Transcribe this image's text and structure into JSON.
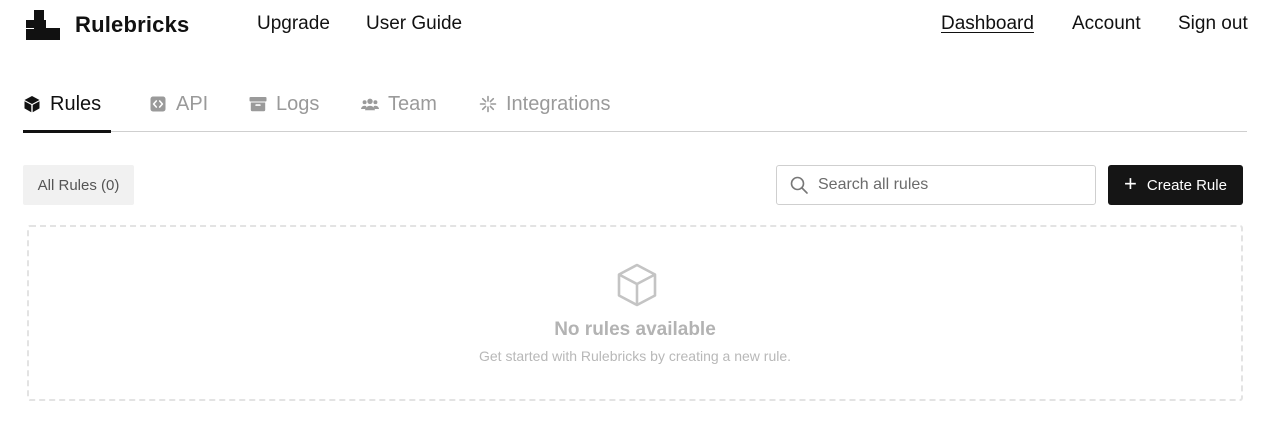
{
  "header": {
    "brand": "Rulebricks",
    "nav_left": [
      "Upgrade",
      "User Guide"
    ],
    "nav_right": [
      "Dashboard",
      "Account",
      "Sign out"
    ]
  },
  "tabs": [
    {
      "label": "Rules",
      "icon": "cube-icon",
      "active": true
    },
    {
      "label": "API",
      "icon": "code-icon",
      "active": false
    },
    {
      "label": "Logs",
      "icon": "archive-icon",
      "active": false
    },
    {
      "label": "Team",
      "icon": "users-icon",
      "active": false
    },
    {
      "label": "Integrations",
      "icon": "sparkle-icon",
      "active": false
    }
  ],
  "toolbar": {
    "filter_label": "All Rules (0)",
    "search_placeholder": "Search all rules",
    "search_value": "",
    "create_label": "Create Rule"
  },
  "empty_state": {
    "title": "No rules available",
    "subtitle": "Get started with Rulebricks by creating a new rule."
  },
  "colors": {
    "primary": "#151515",
    "muted": "#9a9a9a",
    "border": "#cfcfcf"
  }
}
